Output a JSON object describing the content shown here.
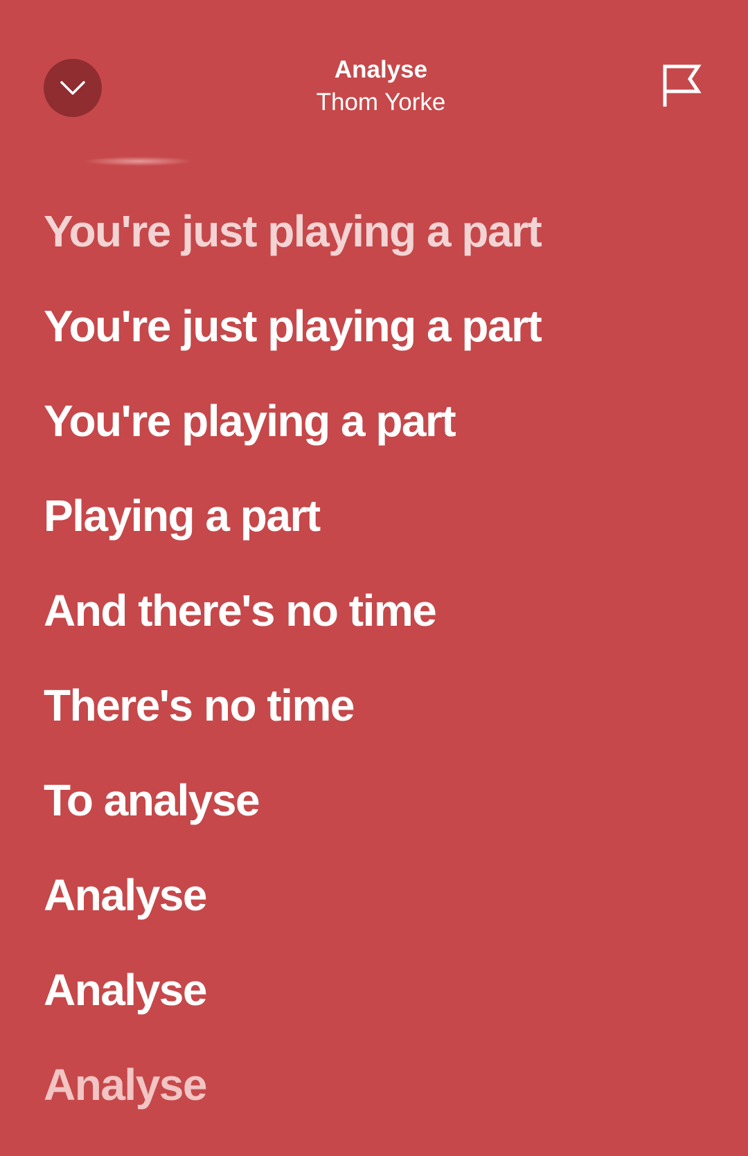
{
  "header": {
    "title": "Analyse",
    "artist": "Thom Yorke",
    "collapse_icon": "chevron-down-icon",
    "report_icon": "flag-icon"
  },
  "colors": {
    "background": "#c6484a",
    "collapse_button": "#8f2d30",
    "text_active": "#ffffff",
    "text_past": "#f3d3d3"
  },
  "lyrics": [
    "You're just playing a part",
    "You're just playing a part",
    "You're playing a part",
    "Playing a part",
    "And there's no time",
    "There's no time",
    "To analyse",
    "Analyse",
    "Analyse",
    "Analyse"
  ]
}
